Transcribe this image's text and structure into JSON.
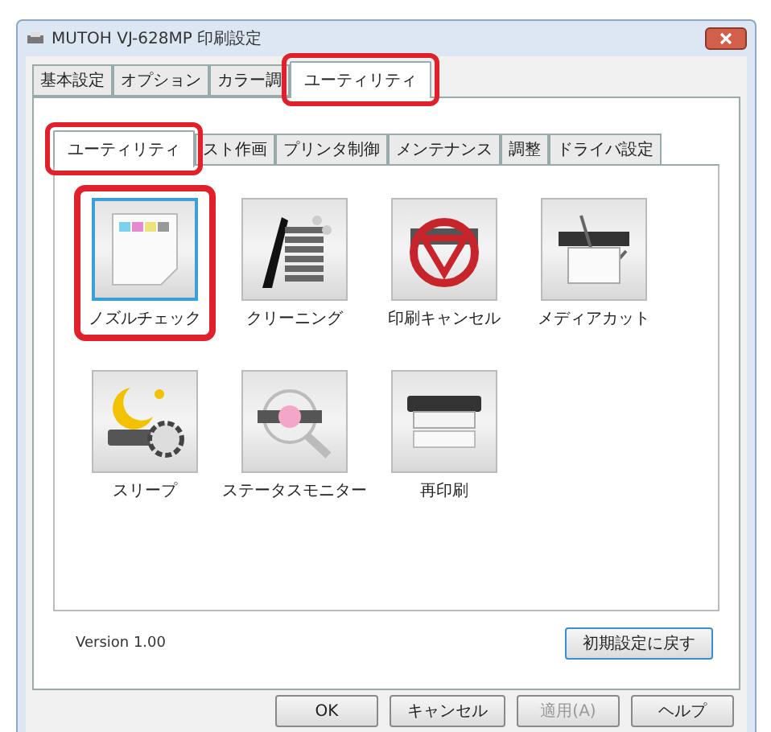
{
  "window": {
    "title": "MUTOH VJ-628MP 印刷設定"
  },
  "tabs": [
    {
      "label": "基本設定",
      "selected": false,
      "highlighted": false
    },
    {
      "label": "オプション",
      "selected": false,
      "highlighted": false
    },
    {
      "label": "カラー調",
      "selected": false,
      "highlighted": false
    },
    {
      "label": "ユーティリティ",
      "selected": true,
      "highlighted": true
    }
  ],
  "subtabs": [
    {
      "label": "ユーティリティ",
      "selected": true,
      "highlighted": true
    },
    {
      "label": "スト作画",
      "selected": false,
      "highlighted": false
    },
    {
      "label": "プリンタ制御",
      "selected": false,
      "highlighted": false
    },
    {
      "label": "メンテナンス",
      "selected": false,
      "highlighted": false
    },
    {
      "label": "調整",
      "selected": false,
      "highlighted": false
    },
    {
      "label": "ドライバ設定",
      "selected": false,
      "highlighted": false
    }
  ],
  "tools": [
    {
      "label": "ノズルチェック",
      "selected": true,
      "highlighted": true
    },
    {
      "label": "クリーニング",
      "selected": false,
      "highlighted": false
    },
    {
      "label": "印刷キャンセル",
      "selected": false,
      "highlighted": false
    },
    {
      "label": "メディアカット",
      "selected": false,
      "highlighted": false
    },
    {
      "label": "スリープ",
      "selected": false,
      "highlighted": false
    },
    {
      "label": "ステータスモニター",
      "selected": false,
      "highlighted": false
    },
    {
      "label": "再印刷",
      "selected": false,
      "highlighted": false
    }
  ],
  "version": "Version 1.00",
  "reset_button": "初期設定に戻す",
  "buttons": [
    {
      "label": "OK",
      "disabled": false
    },
    {
      "label": "キャンセル",
      "disabled": false
    },
    {
      "label": "適用(A)",
      "disabled": true
    },
    {
      "label": "ヘルプ",
      "disabled": false
    }
  ]
}
